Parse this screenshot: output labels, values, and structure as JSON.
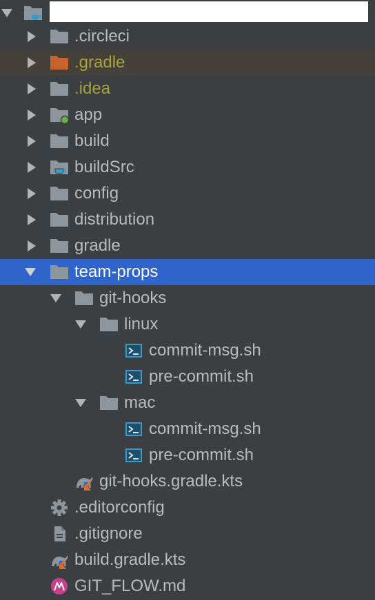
{
  "colors": {
    "background": "#3c3f41",
    "selection": "#2f65ca",
    "excluded_row": "#45413a",
    "excluded_text": "#a5a339",
    "folder": "#8d969c",
    "excluded_folder": "#c7632f",
    "shell_icon": "#3d9ac6",
    "kotlin_accent": "#e46b2c",
    "md_icon": "#c73e8a"
  },
  "tree": {
    "root": {
      "label": "",
      "icon": "project-folder-icon",
      "expanded": true
    },
    "items": [
      {
        "label": ".circleci",
        "icon": "folder-icon",
        "expanded": false
      },
      {
        "label": ".gradle",
        "icon": "excluded-folder-icon",
        "expanded": false
      },
      {
        "label": ".idea",
        "icon": "folder-icon",
        "expanded": false
      },
      {
        "label": "app",
        "icon": "module-folder-icon",
        "expanded": false
      },
      {
        "label": "build",
        "icon": "folder-icon",
        "expanded": false
      },
      {
        "label": "buildSrc",
        "icon": "module-folder-icon",
        "expanded": false
      },
      {
        "label": "config",
        "icon": "folder-icon",
        "expanded": false
      },
      {
        "label": "distribution",
        "icon": "folder-icon",
        "expanded": false
      },
      {
        "label": "gradle",
        "icon": "folder-icon",
        "expanded": false
      },
      {
        "label": "team-props",
        "icon": "folder-icon",
        "expanded": true,
        "selected": true
      },
      {
        "label": "git-hooks",
        "icon": "folder-icon",
        "expanded": true
      },
      {
        "label": "linux",
        "icon": "folder-icon",
        "expanded": true
      },
      {
        "label": "commit-msg.sh",
        "icon": "shell-script-icon"
      },
      {
        "label": "pre-commit.sh",
        "icon": "shell-script-icon"
      },
      {
        "label": "mac",
        "icon": "folder-icon",
        "expanded": true
      },
      {
        "label": "commit-msg.sh",
        "icon": "shell-script-icon"
      },
      {
        "label": "pre-commit.sh",
        "icon": "shell-script-icon"
      },
      {
        "label": "git-hooks.gradle.kts",
        "icon": "gradle-kotlin-icon"
      },
      {
        "label": ".editorconfig",
        "icon": "gear-icon"
      },
      {
        "label": ".gitignore",
        "icon": "text-file-icon"
      },
      {
        "label": "build.gradle.kts",
        "icon": "gradle-kotlin-icon"
      },
      {
        "label": "GIT_FLOW.md",
        "icon": "markdown-icon"
      }
    ]
  }
}
